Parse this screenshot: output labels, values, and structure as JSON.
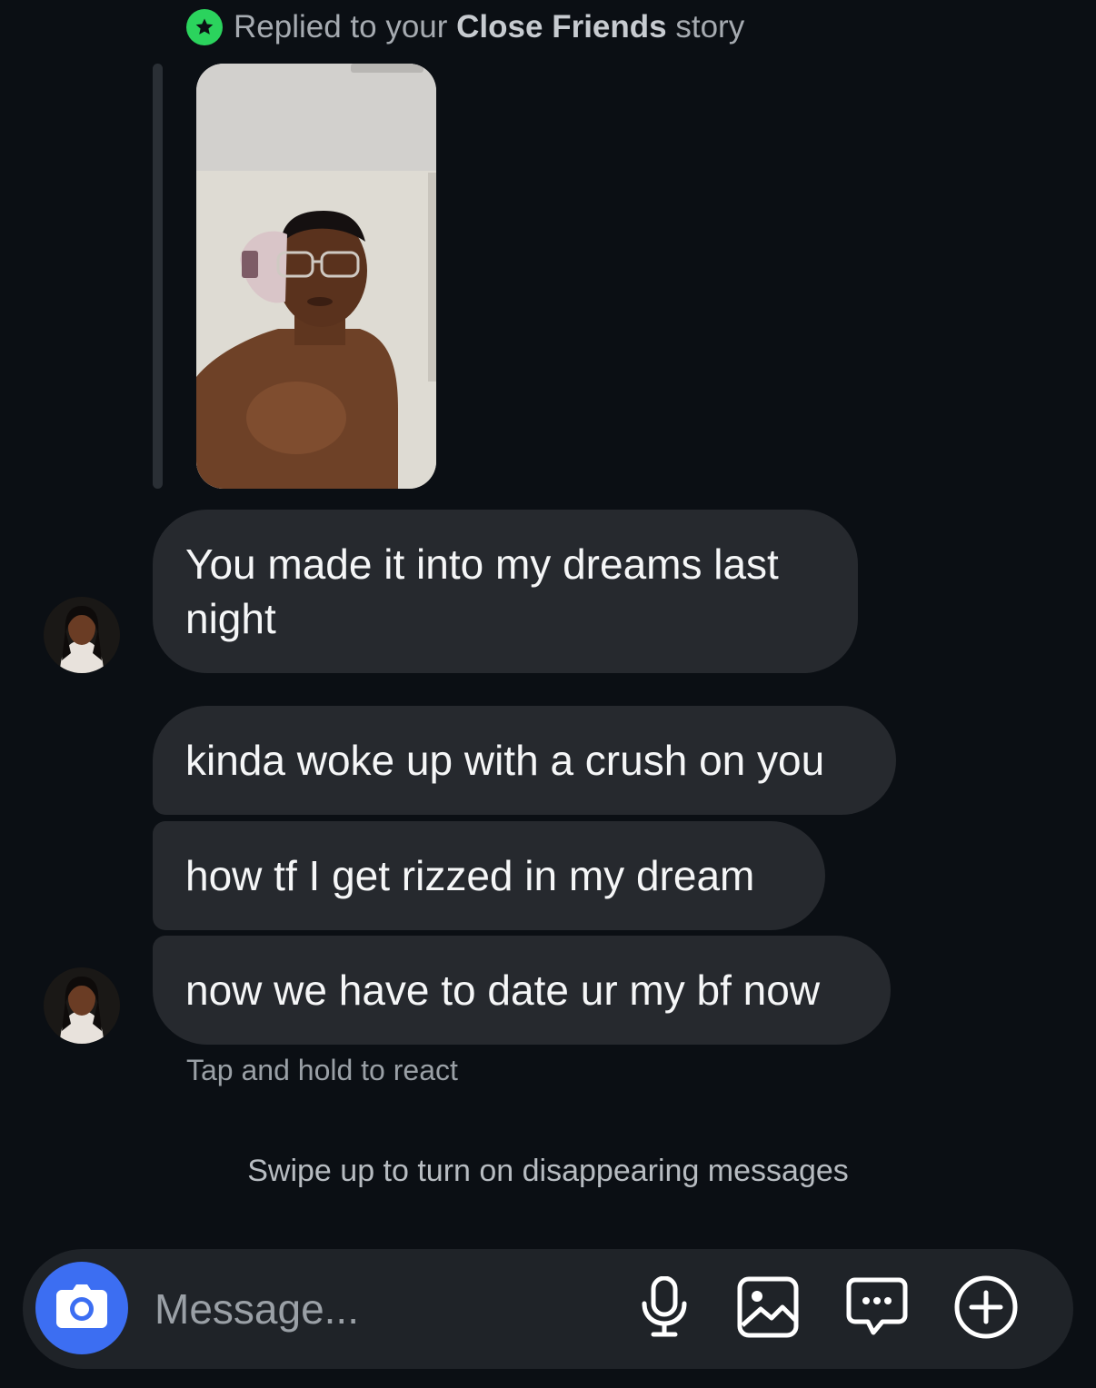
{
  "reply_header": {
    "prefix": "Replied to your",
    "emphasis": "Close Friends",
    "suffix": "story",
    "badge_icon": "star-icon",
    "badge_color": "#2bd35d"
  },
  "story": {
    "thumbnail": "story-thumbnail"
  },
  "messages": [
    {
      "text": "You made it into my dreams last night"
    },
    {
      "text": "kinda woke up with a crush on you"
    },
    {
      "text": "how tf I get rizzed in my dream"
    },
    {
      "text": "now we have to date ur my bf now"
    }
  ],
  "hints": {
    "tap": "Tap and hold to react",
    "swipe": "Swipe up to turn on disappearing messages"
  },
  "composer": {
    "placeholder": "Message...",
    "camera_icon": "camera-icon",
    "mic_icon": "microphone-icon",
    "gallery_icon": "image-icon",
    "sticker_icon": "chat-bubble-icon",
    "add_icon": "plus-circle-icon",
    "camera_color": "#3c6ef2"
  },
  "colors": {
    "background": "#0b0f14",
    "bubble": "#26292e"
  }
}
